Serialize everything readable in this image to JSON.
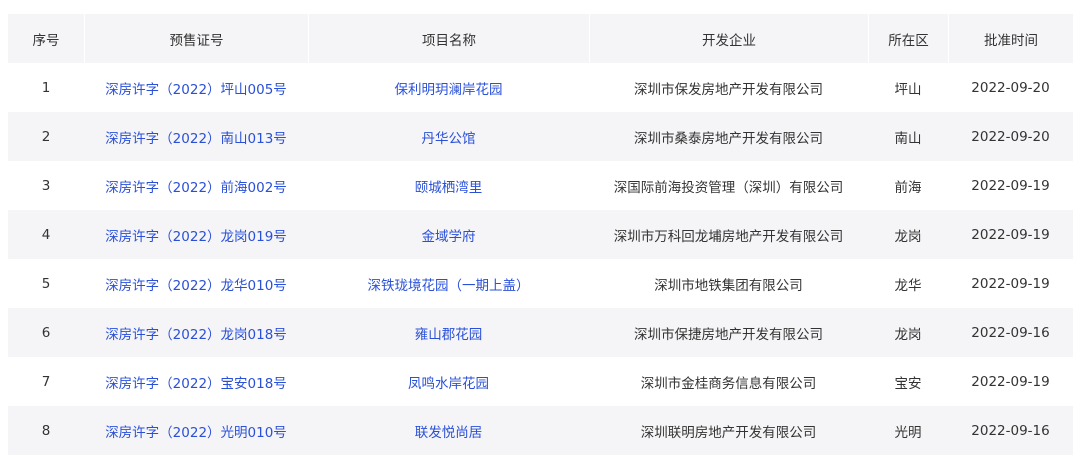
{
  "table": {
    "headers": [
      "序号",
      "预售证号",
      "项目名称",
      "开发企业",
      "所在区",
      "批准时间"
    ],
    "rows": [
      {
        "no": "1",
        "license": "深房许字（2022）坪山005号",
        "project": "保利明玥澜岸花园",
        "developer": "深圳市保发房地产开发有限公司",
        "district": "坪山",
        "date": "2022-09-20"
      },
      {
        "no": "2",
        "license": "深房许字（2022）南山013号",
        "project": "丹华公馆",
        "developer": "深圳市桑泰房地产开发有限公司",
        "district": "南山",
        "date": "2022-09-20"
      },
      {
        "no": "3",
        "license": "深房许字（2022）前海002号",
        "project": "颐城栖湾里",
        "developer": "深国际前海投资管理（深圳）有限公司",
        "district": "前海",
        "date": "2022-09-19"
      },
      {
        "no": "4",
        "license": "深房许字（2022）龙岗019号",
        "project": "金域学府",
        "developer": "深圳市万科回龙埔房地产开发有限公司",
        "district": "龙岗",
        "date": "2022-09-19"
      },
      {
        "no": "5",
        "license": "深房许字（2022）龙华010号",
        "project": "深铁珑境花园（一期上盖）",
        "developer": "深圳市地铁集团有限公司",
        "district": "龙华",
        "date": "2022-09-19"
      },
      {
        "no": "6",
        "license": "深房许字（2022）龙岗018号",
        "project": "雍山郡花园",
        "developer": "深圳市保捷房地产开发有限公司",
        "district": "龙岗",
        "date": "2022-09-16"
      },
      {
        "no": "7",
        "license": "深房许字（2022）宝安018号",
        "project": "凤鸣水岸花园",
        "developer": "深圳市金桂商务信息有限公司",
        "district": "宝安",
        "date": "2022-09-19"
      },
      {
        "no": "8",
        "license": "深房许字（2022）光明010号",
        "project": "联发悦尚居",
        "developer": "深圳联明房地产开发有限公司",
        "district": "光明",
        "date": "2022-09-16"
      }
    ]
  },
  "colors": {
    "header_bg": "#f5f5f7",
    "alt_row_bg": "#f5f5f7",
    "link": "#2a50d8",
    "text": "#333333"
  }
}
